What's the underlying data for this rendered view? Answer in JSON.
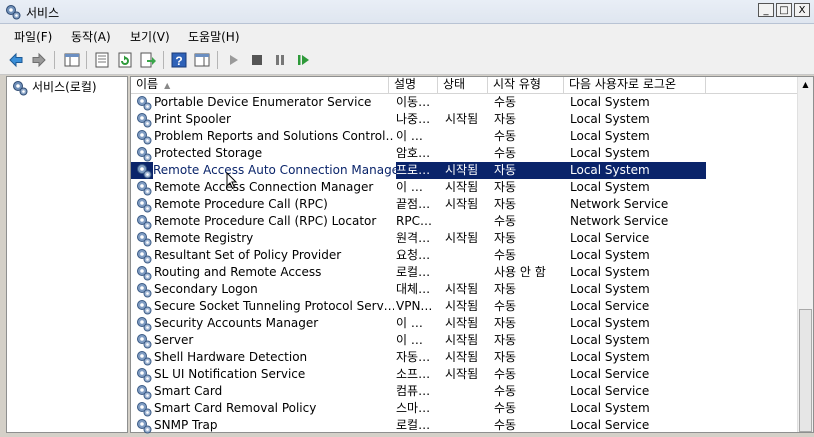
{
  "window": {
    "title": "서비스",
    "minimize": "_",
    "maximize": "□",
    "close": "X"
  },
  "menu": [
    "파일(F)",
    "동작(A)",
    "보기(V)",
    "도움말(H)"
  ],
  "tree": {
    "root_label": "서비스(로컬)"
  },
  "columns": {
    "name": "이름",
    "description": "설명",
    "status": "상태",
    "startup_type": "시작 유형",
    "log_on_as": "다음 사용자로 로그온"
  },
  "services": [
    {
      "name": "Portable Device Enumerator Service",
      "description": "이동…",
      "status": "",
      "startup_type": "수동",
      "log_on_as": "Local System"
    },
    {
      "name": "Print Spooler",
      "description": "나중…",
      "status": "시작됨",
      "startup_type": "자동",
      "log_on_as": "Local System"
    },
    {
      "name": "Problem Reports and Solutions Control…",
      "description": "이 …",
      "status": "",
      "startup_type": "수동",
      "log_on_as": "Local System"
    },
    {
      "name": "Protected Storage",
      "description": "암호…",
      "status": "",
      "startup_type": "수동",
      "log_on_as": "Local System"
    },
    {
      "name": "Remote Access Auto Connection Manager",
      "description": "프로…",
      "status": "시작됨",
      "startup_type": "자동",
      "log_on_as": "Local System",
      "selected": true
    },
    {
      "name": "Remote Access Connection Manager",
      "description": "이 …",
      "status": "시작됨",
      "startup_type": "자동",
      "log_on_as": "Local System"
    },
    {
      "name": "Remote Procedure Call (RPC)",
      "description": "끝점…",
      "status": "시작됨",
      "startup_type": "자동",
      "log_on_as": "Network Service"
    },
    {
      "name": "Remote Procedure Call (RPC) Locator",
      "description": "RPC…",
      "status": "",
      "startup_type": "수동",
      "log_on_as": "Network Service"
    },
    {
      "name": "Remote Registry",
      "description": "원격…",
      "status": "시작됨",
      "startup_type": "자동",
      "log_on_as": "Local Service"
    },
    {
      "name": "Resultant Set of Policy Provider",
      "description": "요청…",
      "status": "",
      "startup_type": "수동",
      "log_on_as": "Local System"
    },
    {
      "name": "Routing and Remote Access",
      "description": "로컬…",
      "status": "",
      "startup_type": "사용 안 함",
      "log_on_as": "Local System"
    },
    {
      "name": "Secondary Logon",
      "description": "대체…",
      "status": "시작됨",
      "startup_type": "자동",
      "log_on_as": "Local System"
    },
    {
      "name": "Secure Socket Tunneling Protocol Serv…",
      "description": "VPN…",
      "status": "시작됨",
      "startup_type": "수동",
      "log_on_as": "Local Service"
    },
    {
      "name": "Security Accounts Manager",
      "description": "이 …",
      "status": "시작됨",
      "startup_type": "자동",
      "log_on_as": "Local System"
    },
    {
      "name": "Server",
      "description": "이 …",
      "status": "시작됨",
      "startup_type": "자동",
      "log_on_as": "Local System"
    },
    {
      "name": "Shell Hardware Detection",
      "description": "자동…",
      "status": "시작됨",
      "startup_type": "자동",
      "log_on_as": "Local System"
    },
    {
      "name": "SL UI Notification Service",
      "description": "소프…",
      "status": "시작됨",
      "startup_type": "수동",
      "log_on_as": "Local Service"
    },
    {
      "name": "Smart Card",
      "description": "컴퓨…",
      "status": "",
      "startup_type": "수동",
      "log_on_as": "Local Service"
    },
    {
      "name": "Smart Card Removal Policy",
      "description": "스마…",
      "status": "",
      "startup_type": "수동",
      "log_on_as": "Local System"
    },
    {
      "name": "SNMP Trap",
      "description": "로컬…",
      "status": "",
      "startup_type": "수동",
      "log_on_as": "Local Service"
    }
  ],
  "colors": {
    "selection": "#0a246a",
    "window_bg": "#d4d0c8",
    "list_bg": "#ffffff"
  }
}
